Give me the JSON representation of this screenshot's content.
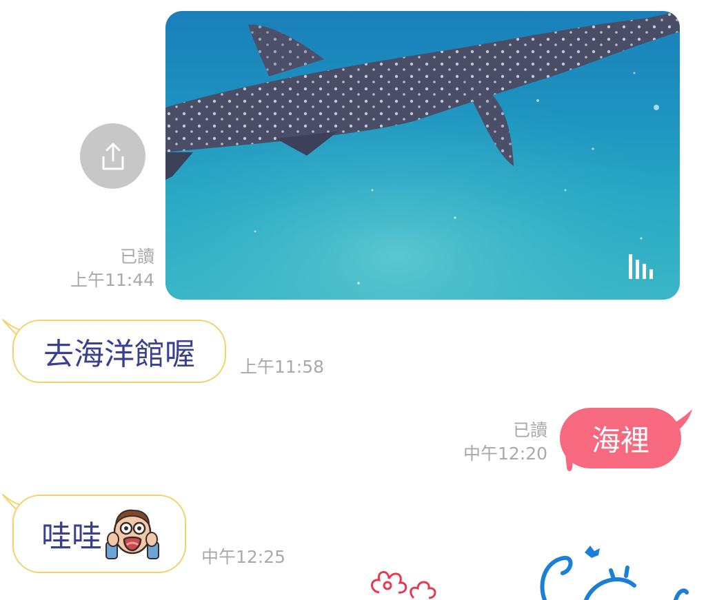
{
  "messages": {
    "video": {
      "read_label": "已讀",
      "time": "上午11:44",
      "share_icon": "share-upload-icon",
      "badge_icon": "video-bars-icon"
    },
    "incoming_1": {
      "text": "去海洋館喔",
      "time": "上午11:58"
    },
    "outgoing_1": {
      "read_label": "已讀",
      "time": "中午12:20",
      "text": "海裡"
    },
    "incoming_2": {
      "text": "哇哇",
      "emoji": "shocked-face-emoji",
      "time": "中午12:25"
    },
    "stickers": [
      "flower-sticker",
      "blue-doodle-sticker"
    ]
  },
  "colors": {
    "outgoing_bubble": "#f7697f",
    "incoming_border": "#f2d36b",
    "incoming_text": "#3a3f8f",
    "meta_text": "#a9a9a9",
    "share_button": "#c7c7c7"
  }
}
